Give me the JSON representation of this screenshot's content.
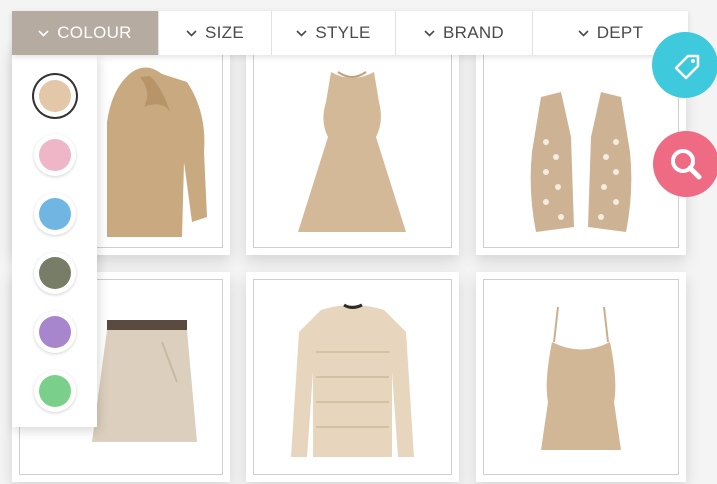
{
  "filters": [
    {
      "label": "COLOUR",
      "active": true
    },
    {
      "label": "SIZE",
      "active": false
    },
    {
      "label": "STYLE",
      "active": false
    },
    {
      "label": "BRAND",
      "active": false
    },
    {
      "label": "DEPT",
      "active": false
    }
  ],
  "colour_options": [
    {
      "name": "beige",
      "color": "#e2c7a8",
      "selected": true
    },
    {
      "name": "pink",
      "color": "#eeb6c6",
      "selected": false
    },
    {
      "name": "blue",
      "color": "#6fb7e2",
      "selected": false
    },
    {
      "name": "olive",
      "color": "#777d66",
      "selected": false
    },
    {
      "name": "purple",
      "color": "#a786ce",
      "selected": false
    },
    {
      "name": "green",
      "color": "#7ad08a",
      "selected": false
    }
  ],
  "products": [
    {
      "name": "bow-blouse"
    },
    {
      "name": "sleeveless-dress"
    },
    {
      "name": "crochet-vest"
    },
    {
      "name": "chino-skirt"
    },
    {
      "name": "knit-sweater"
    },
    {
      "name": "camisole-top"
    }
  ],
  "actions": {
    "tag_button": {
      "icon": "tag-icon",
      "color": "#3fc9dc"
    },
    "search_button": {
      "icon": "search-icon",
      "color": "#ef6a83"
    }
  },
  "colors": {
    "active_tab": "#b6aba1",
    "garment": "#d2b796"
  }
}
